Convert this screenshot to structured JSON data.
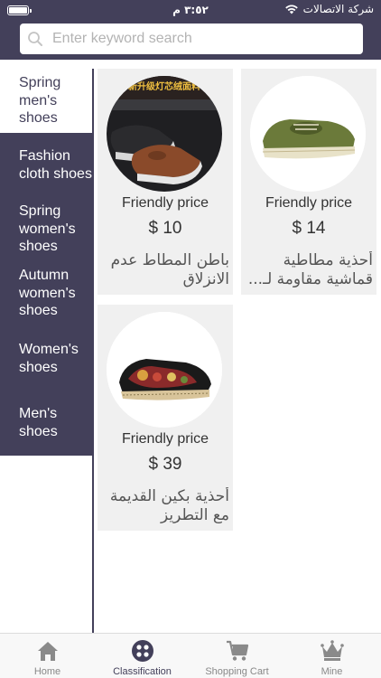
{
  "status_bar": {
    "time": "٣:٥٢ م",
    "carrier": "شركة الاتصالات"
  },
  "search": {
    "placeholder": "Enter keyword search"
  },
  "categories": [
    {
      "label": "Spring men's shoes",
      "active": true
    },
    {
      "label": "Fashion cloth shoes",
      "active": false
    },
    {
      "label": "Spring women's shoes",
      "active": false
    },
    {
      "label": "Autumn women's shoes",
      "active": false
    },
    {
      "label": "Women's shoes",
      "active": false
    },
    {
      "label": "Men's shoes",
      "active": false
    }
  ],
  "products": [
    {
      "price_label": "Friendly price",
      "price": "$ 10",
      "name": "باطن المطاط عدم الانزلاق",
      "image": "black-brown-slip-on-shoes-image"
    },
    {
      "price_label": "Friendly price",
      "price": "$ 14",
      "name": "أحذية مطاطية قماشية مقاومة لـ...",
      "image": "green-canvas-shoes-image"
    },
    {
      "price_label": "Friendly price",
      "price": "$ 39",
      "name": "أحذية بكين القديمة مع التطريز",
      "image": "embroidered-beijing-shoes-image"
    }
  ],
  "tabs": [
    {
      "label": "Home",
      "icon": "home-icon",
      "active": false
    },
    {
      "label": "Classification",
      "icon": "classification-icon",
      "active": true
    },
    {
      "label": "Shopping Cart",
      "icon": "cart-icon",
      "active": false
    },
    {
      "label": "Mine",
      "icon": "crown-icon",
      "active": false
    }
  ],
  "colors": {
    "primary": "#43405a",
    "card_bg": "#f0f0f0"
  }
}
